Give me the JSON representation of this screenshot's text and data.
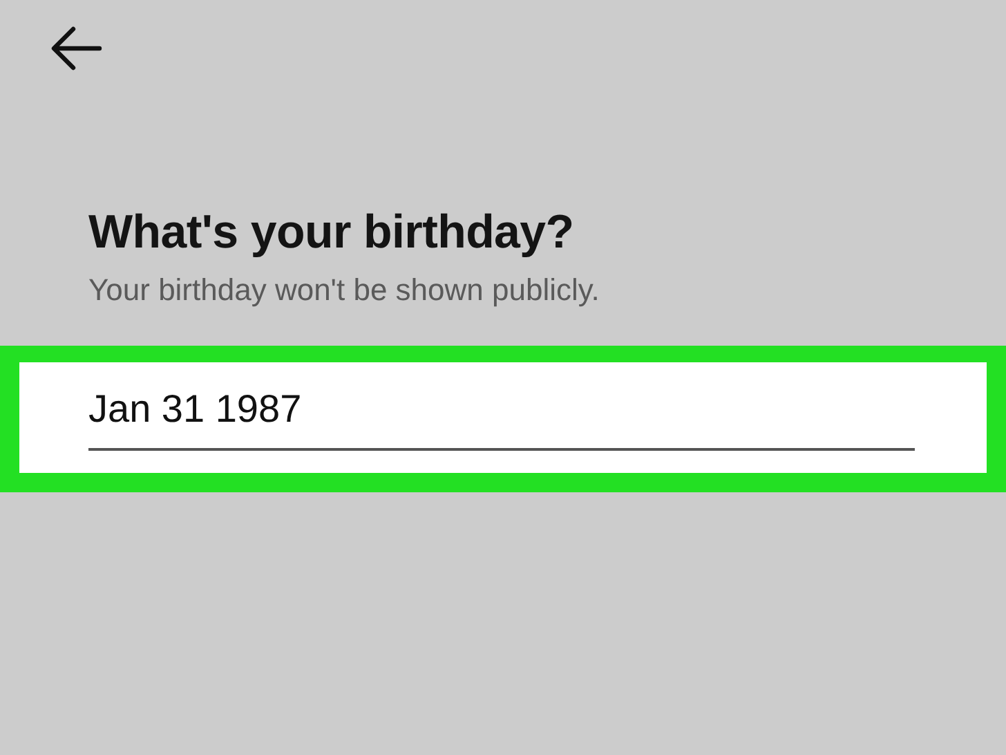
{
  "title": "What's your birthday?",
  "subtitle": "Your birthday won't be shown publicly.",
  "birthday_field": {
    "value": "Jan 31 1987"
  }
}
